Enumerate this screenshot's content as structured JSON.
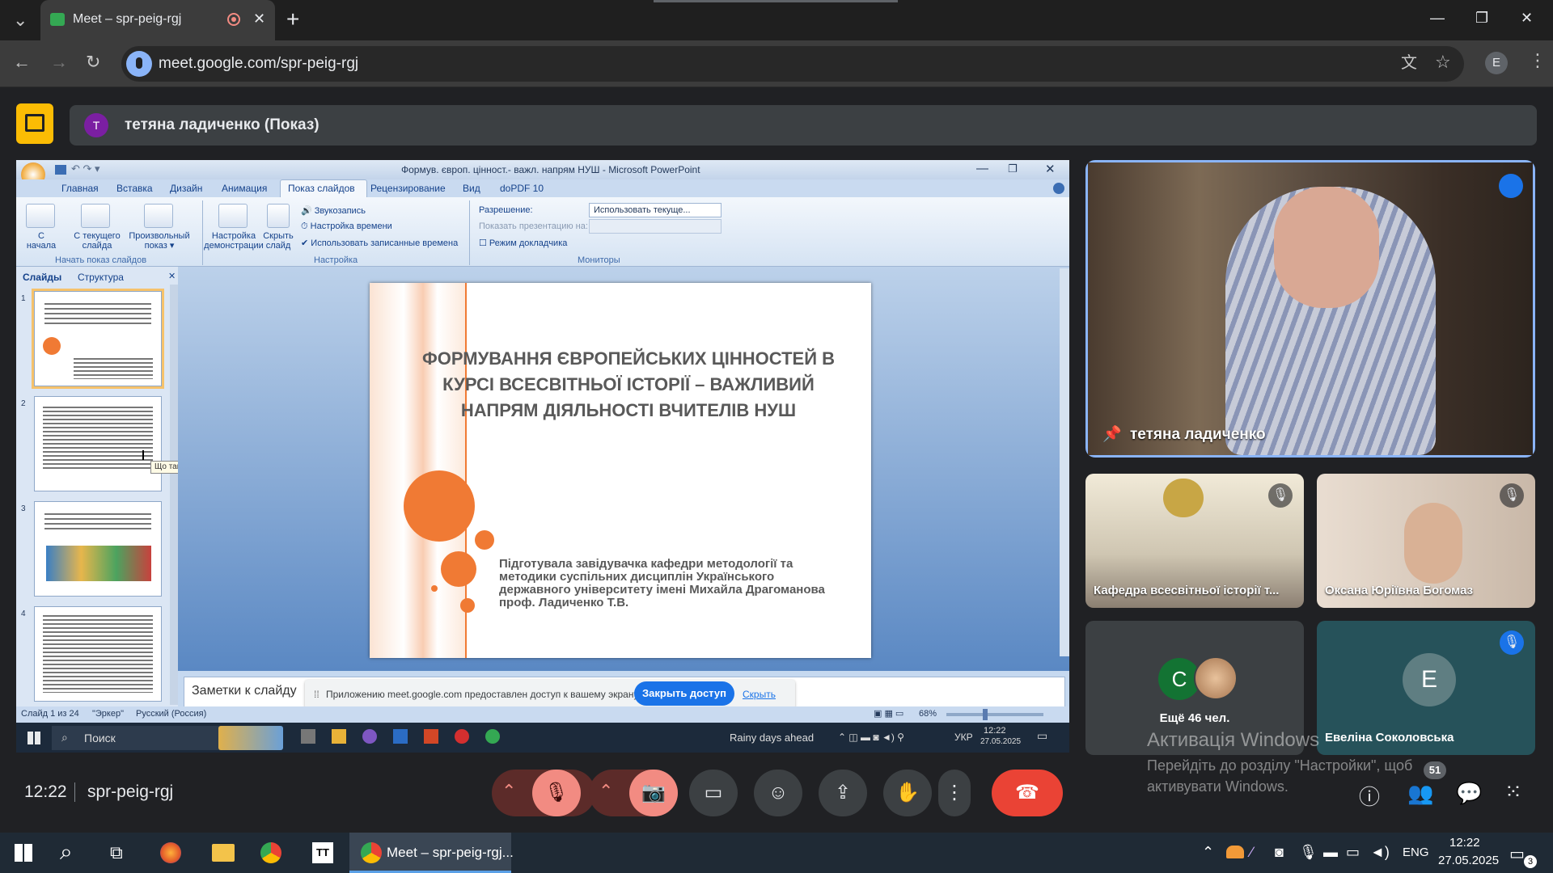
{
  "browser": {
    "tab_title": "Meet – spr-peig-rgj",
    "tab_close": "✕",
    "new_tab": "+",
    "url": "meet.google.com/spr-peig-rgj",
    "profile_initial": "E",
    "window_min": "—",
    "window_max": "❐",
    "window_close": "✕"
  },
  "presenting": {
    "presenter_initial": "Т",
    "label": "тетяна ладиченко (Показ)"
  },
  "ppt": {
    "window_title": "Формув. європ. цінност.- важл. напрям НУШ - Microsoft PowerPoint",
    "tabs": [
      "Главная",
      "Вставка",
      "Дизайн",
      "Анимация",
      "Показ слайдов",
      "Рецензирование",
      "Вид",
      "doPDF 10"
    ],
    "ribbon": {
      "btn_from_start": "С\nначала",
      "btn_from_current": "С текущего\nслайда",
      "btn_custom": "Произвольный\nпоказ ▾",
      "group_start": "Начать показ слайдов",
      "btn_setup": "Настройка\nдемонстрации",
      "btn_hide": "Скрыть\nслайд",
      "opt_record": "Звукозапись",
      "opt_timing": "Настройка времени",
      "opt_use_timings": "Использовать записанные времена",
      "group_setup": "Настройка",
      "lbl_resolution": "Разрешение:",
      "val_resolution": "Использовать текуще...",
      "lbl_show_on": "Показать презентацию на:",
      "lbl_presenter": "Режим докладчика",
      "group_monitors": "Мониторы"
    },
    "left_tabs": [
      "Слайды",
      "Структура"
    ],
    "thumb_numbers": [
      "1",
      "2",
      "3",
      "4"
    ],
    "tooltip": "Що таке європейські цінності?",
    "slide_title": "ФОРМУВАННЯ ЄВРОПЕЙСЬКИХ ЦІННОСТЕЙ В КУРСІ ВСЕСВІТНЬОЇ ІСТОРІЇ – ВАЖЛИВИЙ НАПРЯМ ДІЯЛЬНОСТІ ВЧИТЕЛІВ НУШ",
    "slide_author": "Підготувала завідувачка кафедри методології та методики суспільних дисциплін Українського державного університету імені Михайла Драгоманова проф. Ладиченко Т.В.",
    "notes_placeholder": "Заметки к слайду",
    "status_slide": "Слайд 1 из 24",
    "status_theme": "\"Эркер\"",
    "status_lang": "Русский (Россия)",
    "zoom": "68%",
    "share_notice": "Приложению meet.google.com предоставлен доступ к вашему экрану.",
    "share_stop": "Закрыть доступ",
    "share_hide": "Скрыть",
    "inner_search": "Поиск",
    "inner_weather": "Rainy days ahead",
    "inner_lang": "УКР",
    "inner_time": "12:22",
    "inner_date": "27.05.2025"
  },
  "participants": {
    "main_name": "тетяна ладиченко",
    "tiles": [
      {
        "name": "Кафедра всесвітньої історії т..."
      },
      {
        "name": "Оксана Юріївна Богомаз"
      },
      {
        "name": "Ещё 46 чел."
      },
      {
        "name": "Евеліна Соколовська"
      }
    ],
    "more_initials": [
      "С"
    ],
    "evelina_initial": "E"
  },
  "activation": {
    "title": "Активація Windows",
    "text": "Перейдіть до розділу \"Настройки\", щоб активувати Windows."
  },
  "meet_bar": {
    "time": "12:22",
    "meeting_code": "spr-peig-rgj",
    "people_count": "51"
  },
  "win_taskbar": {
    "app_label": "Meet – spr-peig-rgj...",
    "lang": "ENG",
    "time": "12:22",
    "date": "27.05.2025",
    "notif_count": "3"
  },
  "colors": {
    "slide_orange": "#f07a34",
    "meet_red": "#ea4335",
    "present_yellow": "#fbbc04",
    "active_border": "#8ab4f8"
  }
}
